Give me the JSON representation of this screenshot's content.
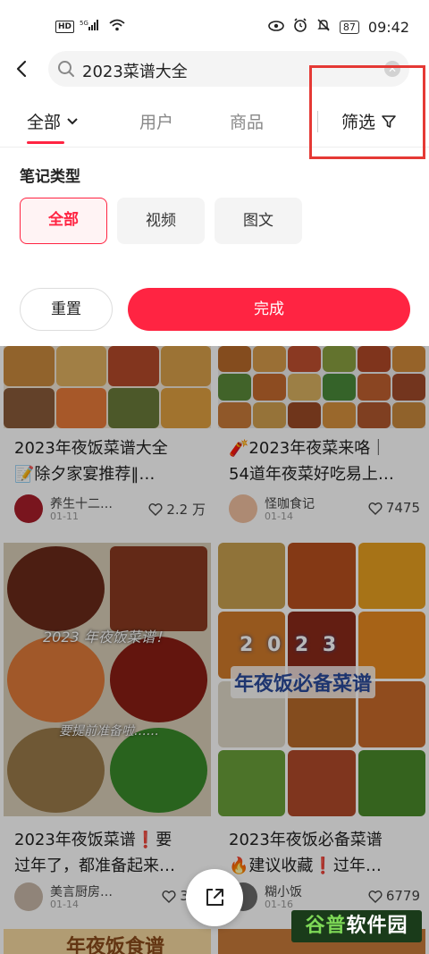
{
  "status_bar": {
    "hd": "HD",
    "network": "5G",
    "battery": "87",
    "time": "09:42"
  },
  "search": {
    "query": "2023菜谱大全",
    "clear_icon": "close-circle-icon"
  },
  "tabs": [
    {
      "label": "全部",
      "active": true
    },
    {
      "label": "用户",
      "active": false
    },
    {
      "label": "商品",
      "active": false
    }
  ],
  "filter": {
    "label": "筛选",
    "icon": "funnel-icon"
  },
  "panel": {
    "section_title": "笔记类型",
    "chips": [
      {
        "label": "全部",
        "active": true
      },
      {
        "label": "视频",
        "active": false
      },
      {
        "label": "图文",
        "active": false
      }
    ],
    "reset_label": "重置",
    "done_label": "完成"
  },
  "feed": {
    "cards": [
      {
        "title": "2023年夜饭菜谱大全\n📝除夕家宴推荐‖…",
        "author": "养生十二…",
        "date": "01-11",
        "likes": "2.2 万"
      },
      {
        "title": "🧨2023年夜菜来咯｜\n54道年夜菜好吃易上…",
        "author": "怪咖食记",
        "date": "01-14",
        "likes": "7475"
      },
      {
        "title": "2023年夜饭菜谱❗要\n过年了，都准备起来…",
        "author": "美言厨房…",
        "date": "01-14",
        "likes": "336"
      },
      {
        "title": "2023年夜饭必备菜谱\n🔥建议收藏❗过年…",
        "author": "糊小饭",
        "date": "01-16",
        "likes": "6779"
      }
    ],
    "image_texts": {
      "card3_overlay": "2023 年夜饭菜谱！",
      "card3_overlay2": "要提前准备啦……",
      "card4_overlay": "2 0 2 3",
      "card4_overlay2": "年夜饭必备菜谱",
      "card5_overlay": "年夜饭食谱"
    }
  },
  "watermark": {
    "text_green": "谷普",
    "text_white": "软件园"
  },
  "colors": {
    "accent": "#ff2442",
    "highlight_box": "#e53935"
  }
}
